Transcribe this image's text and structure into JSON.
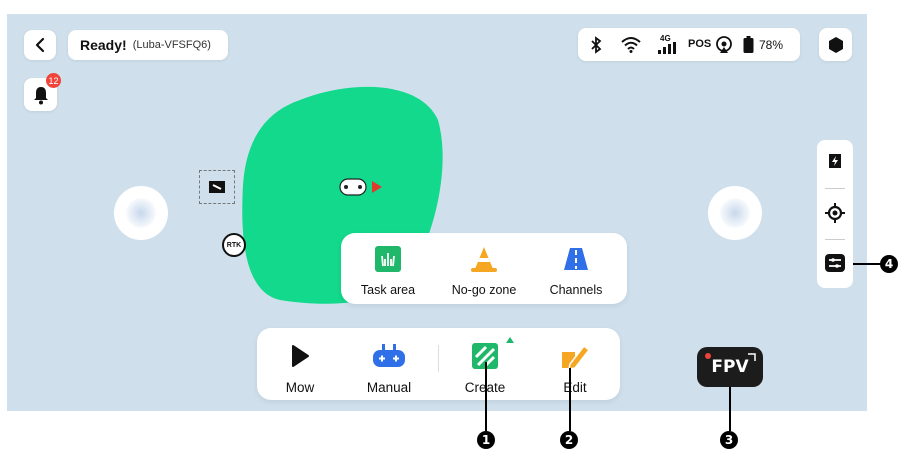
{
  "status": {
    "title": "Ready!",
    "device": "(Luba-VFSFQ6)"
  },
  "top_bar": {
    "network_4g": "4G",
    "pos_label": "POS",
    "battery": "78%"
  },
  "notifications": {
    "badge": "12"
  },
  "map": {
    "rtk_label": "RTK"
  },
  "create_menu": {
    "items": [
      {
        "label": "Task area",
        "icon": "grass-icon"
      },
      {
        "label": "No-go zone",
        "icon": "traffic-cone-icon"
      },
      {
        "label": "Channels",
        "icon": "road-icon"
      }
    ]
  },
  "toolbar": {
    "items": [
      {
        "label": "Mow",
        "icon": "play-icon"
      },
      {
        "label": "Manual",
        "icon": "gamepad-icon"
      },
      {
        "label": "Create",
        "icon": "create-area-icon"
      },
      {
        "label": "Edit",
        "icon": "edit-pencil-icon"
      }
    ]
  },
  "fpv": {
    "label": "FPV"
  },
  "callouts": [
    "1",
    "2",
    "3",
    "4"
  ],
  "colors": {
    "map_bg": "#cfe0ec",
    "lawn": "#12d98c",
    "accent_green": "#1fb86a",
    "orange": "#f5a623",
    "blue": "#2f6fe8",
    "badge": "#f0443a"
  }
}
